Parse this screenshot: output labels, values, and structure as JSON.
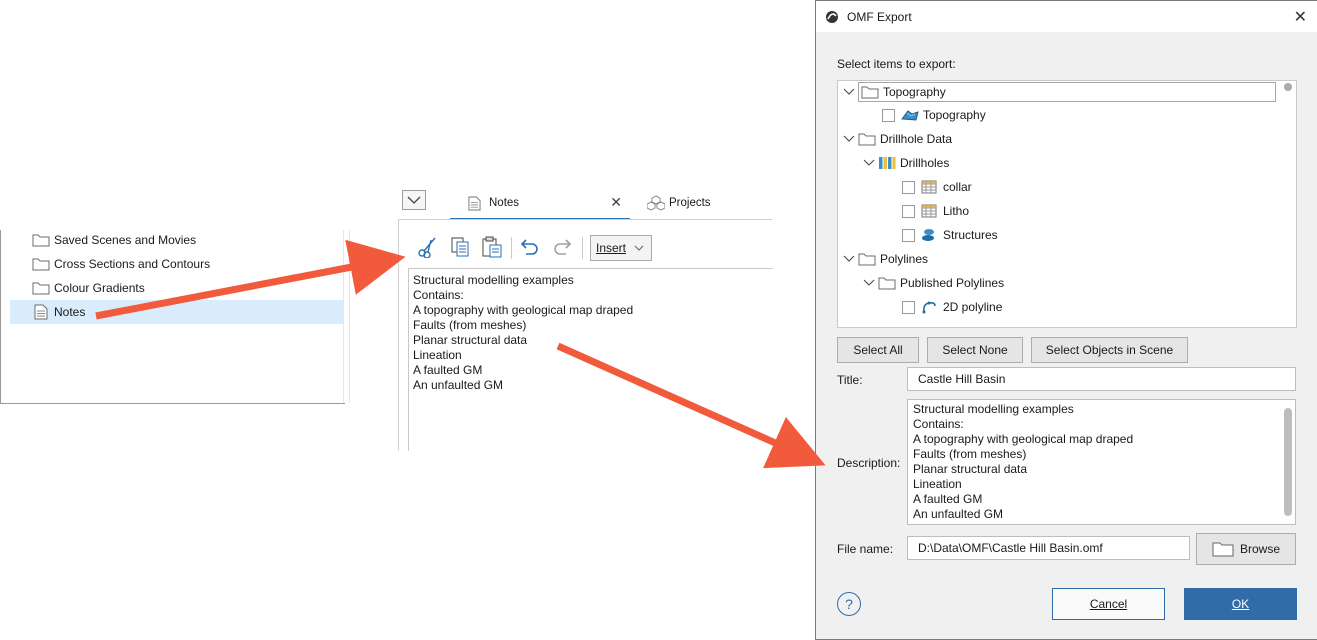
{
  "project_tree": {
    "items": [
      {
        "label": "Saved Scenes and Movies",
        "icon": "folder-icon"
      },
      {
        "label": "Cross Sections and Contours",
        "icon": "folder-icon"
      },
      {
        "label": "Colour Gradients",
        "icon": "folder-icon"
      },
      {
        "label": "Notes",
        "icon": "note-icon",
        "selected": true
      }
    ]
  },
  "notes_panel": {
    "tab_notes": "Notes",
    "tab_projects": "Projects",
    "insert_label": "Insert",
    "lines": [
      "Structural modelling examples",
      "Contains:",
      "A topography with geological map draped",
      "Faults (from meshes)",
      "Planar structural data",
      "Lineation",
      "A faulted GM",
      "An unfaulted GM"
    ]
  },
  "dialog": {
    "title": "OMF Export",
    "select_label": "Select items to export:",
    "tree": [
      {
        "label": "Topography",
        "level": 0,
        "type": "folder",
        "expanded": true
      },
      {
        "label": "Topography",
        "level": 1,
        "type": "item",
        "icon": "surface-icon"
      },
      {
        "label": "Drillhole Data",
        "level": 0,
        "type": "folder",
        "expanded": true
      },
      {
        "label": "Drillholes",
        "level": 1,
        "type": "drillholes",
        "expanded": true
      },
      {
        "label": "collar",
        "level": 2,
        "type": "item",
        "icon": "table-icon"
      },
      {
        "label": "Litho",
        "level": 2,
        "type": "item",
        "icon": "table-icon"
      },
      {
        "label": "Structures",
        "level": 2,
        "type": "item",
        "icon": "disc-icon"
      },
      {
        "label": "Polylines",
        "level": 0,
        "type": "folder",
        "expanded": true
      },
      {
        "label": "Published Polylines",
        "level": 1,
        "type": "folder",
        "expanded": true
      },
      {
        "label": "2D polyline",
        "level": 2,
        "type": "item",
        "icon": "polyline-icon"
      }
    ],
    "buttons": {
      "select_all": "Select All",
      "select_none": "Select None",
      "select_objects": "Select Objects in Scene",
      "browse": "Browse",
      "cancel": "Cancel",
      "ok": "OK"
    },
    "title_label": "Title:",
    "title_value": "Castle Hill Basin",
    "description_label": "Description:",
    "description_lines": [
      "Structural modelling examples",
      "Contains:",
      "A topography with geological map draped",
      "Faults (from meshes)",
      "Planar structural data",
      "Lineation",
      "A faulted GM",
      "An unfaulted GM"
    ],
    "filename_label": "File name:",
    "filename_value": "D:\\Data\\OMF\\Castle Hill Basin.omf"
  },
  "colors": {
    "accent_blue": "#2c73b6",
    "ok_button": "#2f6ca8",
    "arrow": "#f25a3c",
    "selection": "#d8ecfb"
  }
}
